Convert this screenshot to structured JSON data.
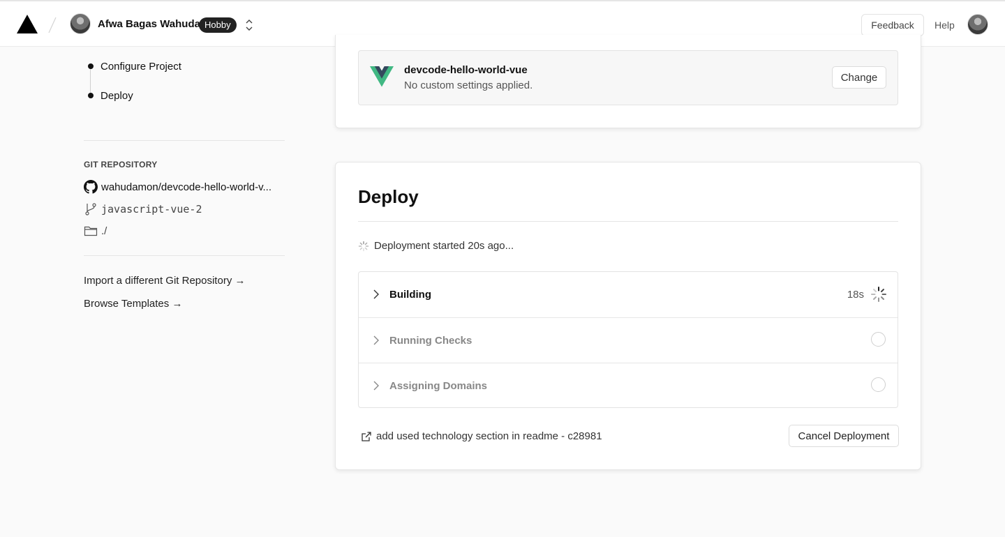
{
  "header": {
    "team_name": "Afwa Bagas Wahuda",
    "plan_badge": "Hobby",
    "feedback_label": "Feedback",
    "help_label": "Help"
  },
  "sidebar": {
    "steps": [
      {
        "label": "Configure Project"
      },
      {
        "label": "Deploy"
      }
    ],
    "git_section_label": "GIT REPOSITORY",
    "repo_name": "wahudamon/devcode-hello-world-v...",
    "branch": "javascript-vue-2",
    "root_dir": "./",
    "links": [
      {
        "label": "Import a different Git Repository →"
      },
      {
        "label": "Browse Templates →"
      }
    ]
  },
  "framework": {
    "name": "devcode-hello-world-vue",
    "subtitle": "No custom settings applied.",
    "change_label": "Change",
    "logo_colors": {
      "outer": "#41b883",
      "inner": "#35495e"
    }
  },
  "deploy": {
    "title": "Deploy",
    "status_text": "Deployment started 20s ago...",
    "steps": [
      {
        "label": "Building",
        "time": "18s",
        "state": "in-progress"
      },
      {
        "label": "Running Checks",
        "state": "pending"
      },
      {
        "label": "Assigning Domains",
        "state": "pending"
      }
    ],
    "commit_text": "add used technology section in readme - c28981",
    "cancel_label": "Cancel Deployment"
  }
}
